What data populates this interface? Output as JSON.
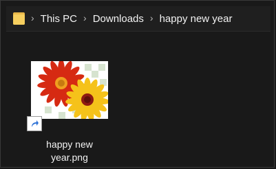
{
  "breadcrumb": {
    "items": [
      "This PC",
      "Downloads",
      "happy new year"
    ]
  },
  "file": {
    "line1": "happy new",
    "line2": "year.png",
    "icon": "shortcut-arrow-icon"
  },
  "colors": {
    "background": "#191919",
    "folder": "#f6cf5f",
    "text": "#f2f2f2"
  }
}
